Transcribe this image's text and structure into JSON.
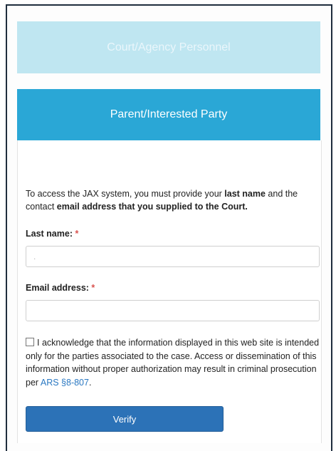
{
  "tabs": {
    "court_label": "Court/Agency Personnel",
    "parent_label": "Parent/Interested Party"
  },
  "intro": {
    "part1": "To access the JAX system, you must provide your ",
    "bold1": "last name",
    "part2": " and the contact ",
    "bold2": "email address that you supplied to the Court."
  },
  "form": {
    "last_name_label": "Last name:",
    "last_name_value": ".",
    "email_label": "Email address:",
    "email_value": "",
    "required_marker": "*"
  },
  "acknowledgement": {
    "text": "I acknowledge that the information displayed in this web site is intended only for the parties associated to the case. Access or dissemination of this information without proper authorization may result in criminal prosecution per ",
    "link_text": "ARS §8-807",
    "suffix": "."
  },
  "buttons": {
    "verify_label": "Verify"
  },
  "colors": {
    "court_tab": "#bfe6f1",
    "parent_tab": "#2aa7d6",
    "verify_button": "#2c72b7",
    "required": "#d9534f",
    "link": "#2a78c2"
  }
}
